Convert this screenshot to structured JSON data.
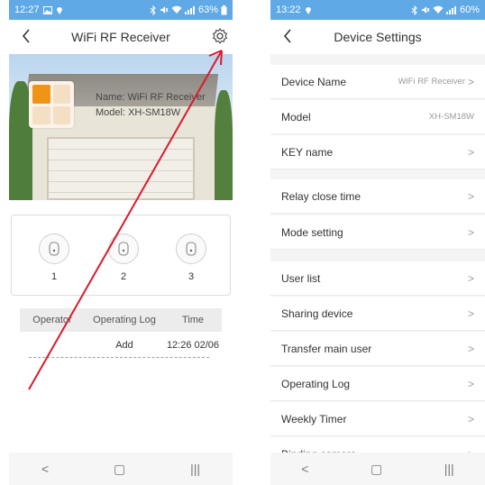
{
  "left": {
    "status": {
      "time": "12:27",
      "right_text": "63%"
    },
    "header": {
      "title": "WiFi RF Receiver"
    },
    "device": {
      "name_line": "Name: WiFi RF Receiver",
      "model_line": "Model: XH-SM18W"
    },
    "keys": [
      "1",
      "2",
      "3"
    ],
    "log": {
      "columns": [
        "Operator",
        "Operating Log",
        "Time"
      ],
      "rows": [
        {
          "operator": "",
          "log": "Add",
          "time": "12:26 02/06"
        }
      ]
    },
    "nav": {
      "back": "<",
      "home": "▢",
      "recents": "|||"
    }
  },
  "right": {
    "status": {
      "time": "13:22",
      "right_text": "60%"
    },
    "header": {
      "title": "Device Settings"
    },
    "rows": [
      {
        "label": "Device Name",
        "value": "WiFi RF Receiver",
        "chevron": ">"
      },
      {
        "label": "Model",
        "value": "XH-SM18W",
        "chevron": ""
      },
      {
        "label": "KEY name",
        "value": "",
        "chevron": ">"
      },
      {
        "label": "Relay close time",
        "value": "",
        "chevron": ">"
      },
      {
        "label": "Mode setting",
        "value": "",
        "chevron": ">"
      },
      {
        "label": "User list",
        "value": "",
        "chevron": ">"
      },
      {
        "label": "Sharing device",
        "value": "",
        "chevron": ">"
      },
      {
        "label": "Transfer main user",
        "value": "",
        "chevron": ">"
      },
      {
        "label": "Operating Log",
        "value": "",
        "chevron": ">"
      },
      {
        "label": "Weekly Timer",
        "value": "",
        "chevron": ">"
      },
      {
        "label": "Binding camera",
        "value": "",
        "chevron": ">"
      }
    ],
    "nav": {
      "back": "<",
      "home": "▢",
      "recents": "|||"
    }
  },
  "colors": {
    "annotation_arrow": "#d81b2f",
    "tile_active": "#ef9416",
    "tile_inactive": "#f5dfc4"
  }
}
